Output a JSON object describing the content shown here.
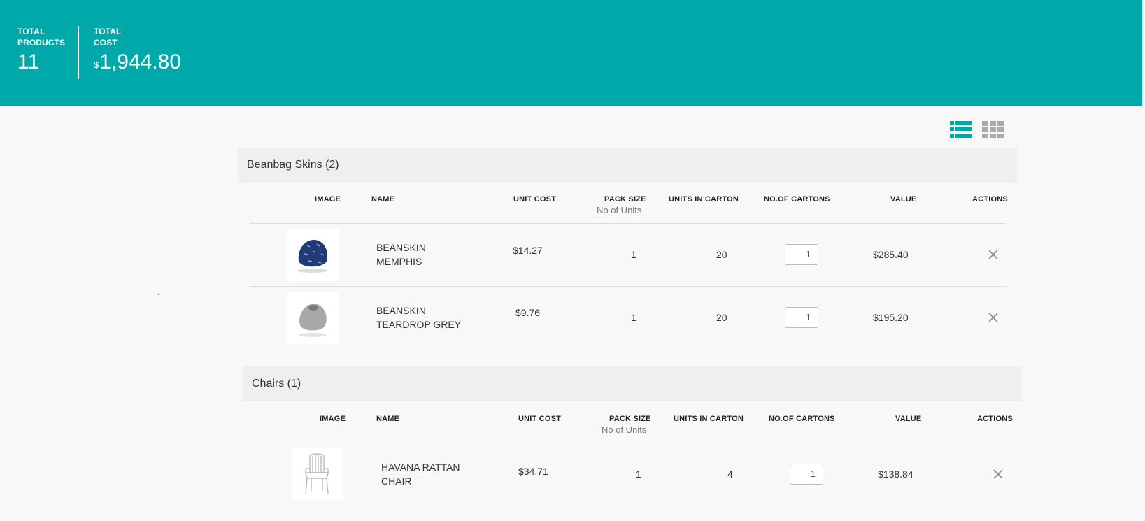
{
  "summary": {
    "total_products_label": "TOTAL PRODUCTS",
    "total_products_value": "11",
    "total_cost_label": "TOTAL COST",
    "currency_symbol": "$",
    "total_cost_value": "1,944.80"
  },
  "colors": {
    "accent": "#00a9a9",
    "group_bg": "#efefef",
    "page_bg": "#f8f8f8"
  },
  "view_toggles": [
    "list-view-icon",
    "grid-view-icon"
  ],
  "columns": {
    "image": "IMAGE",
    "name": "NAME",
    "unit_cost": "UNIT COST",
    "pack_size": "PACK SIZE",
    "pack_size_sub": "No of Units",
    "units_in_carton": "UNITS IN CARTON",
    "no_of_cartons": "NO.OF CARTONS",
    "value": "VALUE",
    "actions": "ACTIONS"
  },
  "groups": [
    {
      "title": "Beanbag Skins (2)",
      "items": [
        {
          "name": "BEANSKIN MEMPHIS",
          "unit_cost": "$14.27",
          "pack_size": "1",
          "units_in_carton": "20",
          "cartons": "1",
          "value": "$285.40",
          "image": "blue-beanbag-image"
        },
        {
          "name": "BEANSKIN TEARDROP GREY",
          "unit_cost": "$9.76",
          "pack_size": "1",
          "units_in_carton": "20",
          "cartons": "1",
          "value": "$195.20",
          "image": "grey-beanbag-image"
        }
      ]
    },
    {
      "title": "Chairs (1)",
      "items": [
        {
          "name": "HAVANA RATTAN CHAIR",
          "unit_cost": "$34.71",
          "pack_size": "1",
          "units_in_carton": "4",
          "cartons": "1",
          "value": "$138.84",
          "image": "white-chair-image"
        }
      ]
    }
  ]
}
